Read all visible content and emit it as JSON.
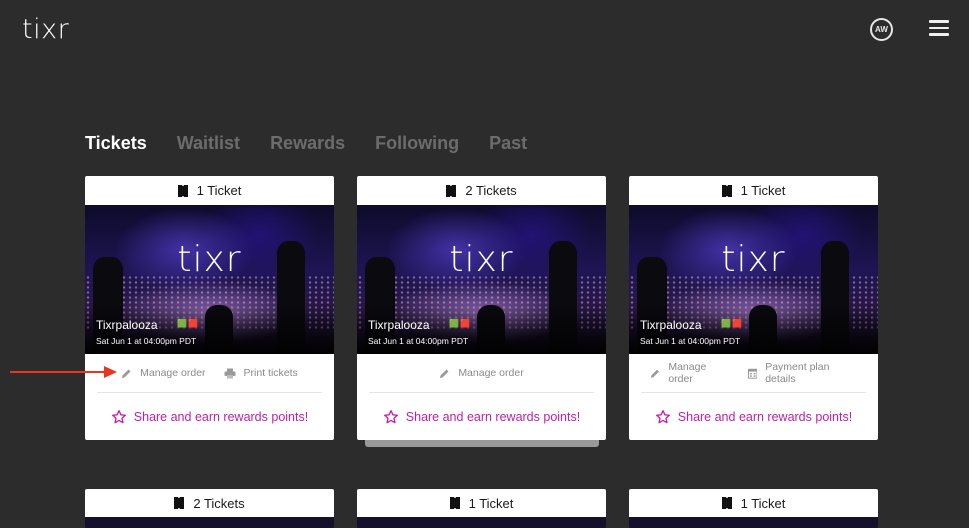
{
  "brand": {
    "logo": "tixr"
  },
  "header": {
    "avatar_initials": "AW"
  },
  "tabs": [
    {
      "label": "Tickets",
      "active": true
    },
    {
      "label": "Waitlist",
      "active": false
    },
    {
      "label": "Rewards",
      "active": false
    },
    {
      "label": "Following",
      "active": false
    },
    {
      "label": "Past",
      "active": false
    }
  ],
  "cards": [
    {
      "ticket_count": "1 Ticket",
      "image_watermark": "tixr",
      "event_name": "Tixrpalooza",
      "event_date": "Sat Jun 1 at 04:00pm PDT",
      "actions": [
        {
          "icon": "pencil-icon",
          "label": "Manage order"
        },
        {
          "icon": "printer-icon",
          "label": "Print tickets"
        }
      ],
      "share_label": "Share and earn rewards points!"
    },
    {
      "ticket_count": "2 Tickets",
      "image_watermark": "tixr",
      "event_name": "Tixrpalooza",
      "event_date": "Sat Jun 1 at 04:00pm PDT",
      "actions": [
        {
          "icon": "pencil-icon",
          "label": "Manage order"
        }
      ],
      "share_label": "Share and earn rewards points!"
    },
    {
      "ticket_count": "1 Ticket",
      "image_watermark": "tixr",
      "event_name": "Tixrpalooza",
      "event_date": "Sat Jun 1 at 04:00pm PDT",
      "actions": [
        {
          "icon": "pencil-icon",
          "label": "Manage order"
        },
        {
          "icon": "calendar-icon",
          "label": "Payment plan details"
        }
      ],
      "share_label": "Share and earn rewards points!"
    }
  ],
  "bottom_cards": [
    {
      "ticket_count": "2 Tickets"
    },
    {
      "ticket_count": "1 Ticket"
    },
    {
      "ticket_count": "1 Ticket"
    }
  ],
  "colors": {
    "background": "#2c2c2c",
    "accent_share": "#c01fa8",
    "annotation_arrow": "#e8361f",
    "tab_active": "#ffffff",
    "tab_inactive": "#6c6c6c"
  }
}
